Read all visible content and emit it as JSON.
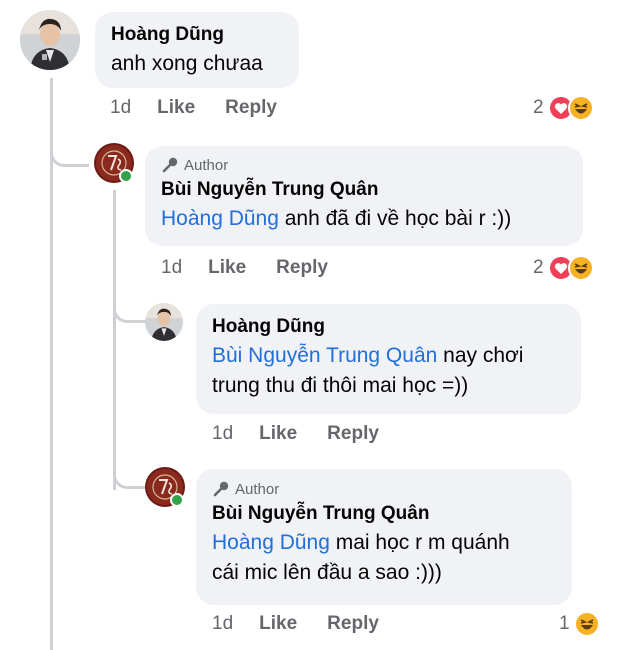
{
  "comments": [
    {
      "author": "Hoàng Dũng",
      "text": "anh xong chưaa",
      "time": "1d",
      "like_label": "Like",
      "reply_label": "Reply",
      "reaction_count": "2",
      "reactions": [
        "love",
        "haha"
      ]
    },
    {
      "badge": "Author",
      "author": "Bùi Nguyễn Trung Quân",
      "mention": "Hoàng Dũng",
      "text": " anh đã đi về học bài r :))",
      "time": "1d",
      "like_label": "Like",
      "reply_label": "Reply",
      "reaction_count": "2",
      "reactions": [
        "love",
        "haha"
      ]
    },
    {
      "author": "Hoàng Dũng",
      "mention": "Bùi Nguyễn Trung Quân",
      "text_line1": " nay chơi",
      "text_line2": "trung thu đi thôi mai học =))",
      "time": "1d",
      "like_label": "Like",
      "reply_label": "Reply"
    },
    {
      "badge": "Author",
      "author": "Bùi Nguyễn Trung Quân",
      "mention": "Hoàng Dũng",
      "text_line1": " mai học r m quánh",
      "text_line2": "cái mic lên đầu a sao :)))",
      "time": "1d",
      "like_label": "Like",
      "reply_label": "Reply",
      "reaction_count": "1",
      "reactions": [
        "haha"
      ]
    }
  ],
  "colors": {
    "bubble": "#f0f2f5",
    "mention": "#216fdb",
    "meta": "#65676b",
    "love": "#f33e58",
    "haha": "#f7b125",
    "online": "#31a24c"
  }
}
